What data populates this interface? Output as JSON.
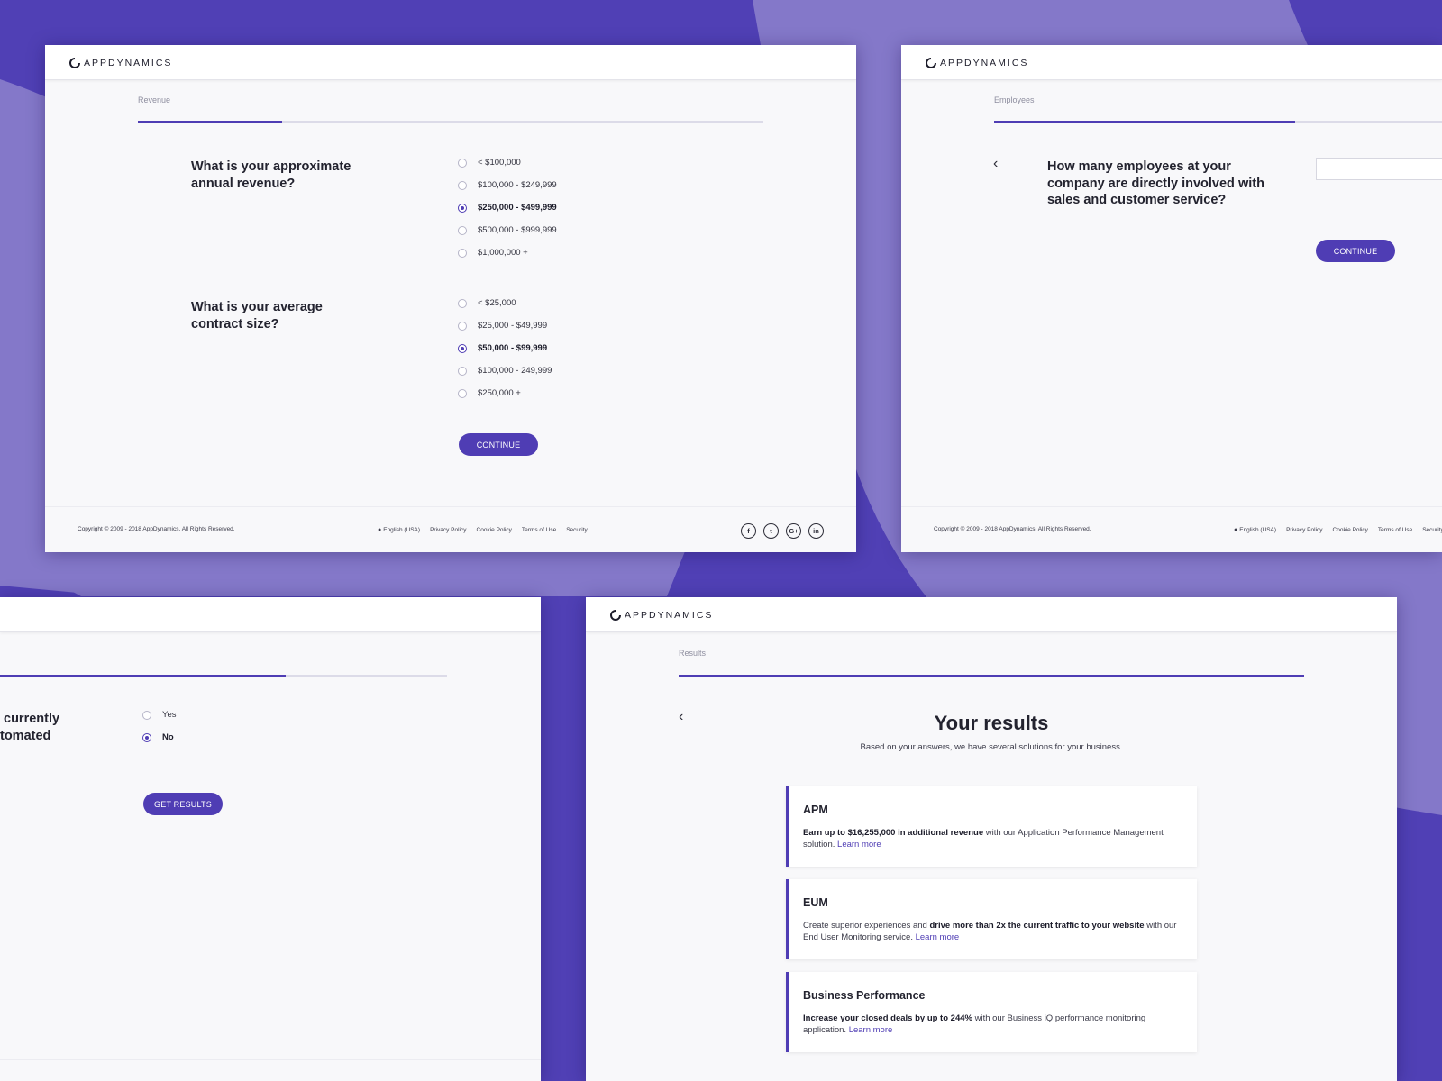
{
  "colors": {
    "background": "#5040b5",
    "accent": "#4f3db4",
    "screen_bg": "#f8f8fa"
  },
  "brand": {
    "logo_text": "APPDYNAMICS"
  },
  "footer": {
    "copyright": "Copyright © 2009 - 2018 AppDynamics. All Rights Reserved.",
    "language": "English (USA)",
    "links": [
      "Privacy Policy",
      "Cookie Policy",
      "Terms of Use",
      "Security"
    ],
    "socials": [
      "facebook-icon",
      "twitter-icon",
      "google-plus-icon",
      "linkedin-icon"
    ],
    "social_glyphs": [
      "f",
      "t",
      "G+",
      "in"
    ]
  },
  "revenue_screen": {
    "step_label": "Revenue",
    "progress": 0.23,
    "question1": "What is your approximate annual revenue?",
    "options1": [
      "< $100,000",
      "$100,000 - $249,999",
      "$250,000 - $499,999",
      "$500,000 - $999,999",
      "$1,000,000 +"
    ],
    "selected1": 2,
    "question2": "What is your average contract size?",
    "options2": [
      "< $25,000",
      "$25,000 - $49,999",
      "$50,000 - $99,999",
      "$100,000 - 249,999",
      "$250,000 +"
    ],
    "selected2": 2,
    "continue_label": "CONTINUE"
  },
  "employees_screen": {
    "step_label": "Employees",
    "progress": 0.47,
    "question": "How many employees at your company are directly involved with sales and customer service?",
    "input_value": "",
    "continue_label": "CONTINUE"
  },
  "automation_screen": {
    "progress": 0.64,
    "question_fragment_line1": "currently",
    "question_fragment_line2": "tomated",
    "options": [
      "Yes",
      "No"
    ],
    "selected": 1,
    "button_label": "GET RESULTS"
  },
  "results_screen": {
    "step_label": "Results",
    "progress": 1.0,
    "title": "Your results",
    "subtitle": "Based on your answers, we have several solutions for your business.",
    "cards": [
      {
        "title": "APM",
        "bold": "Earn up to $16,255,000 in additional revenue",
        "text": " with our Application Performance Management solution. ",
        "link": "Learn more"
      },
      {
        "title": "EUM",
        "pre": "Create superior experiences and ",
        "bold": "drive more than 2x the current traffic to your website",
        "text": " with our End User Monitoring service. ",
        "link": "Learn more"
      },
      {
        "title": "Business Performance",
        "bold": "Increase your closed deals by up to 244%",
        "text": " with our Business iQ performance monitoring application. ",
        "link": "Learn more"
      }
    ]
  }
}
